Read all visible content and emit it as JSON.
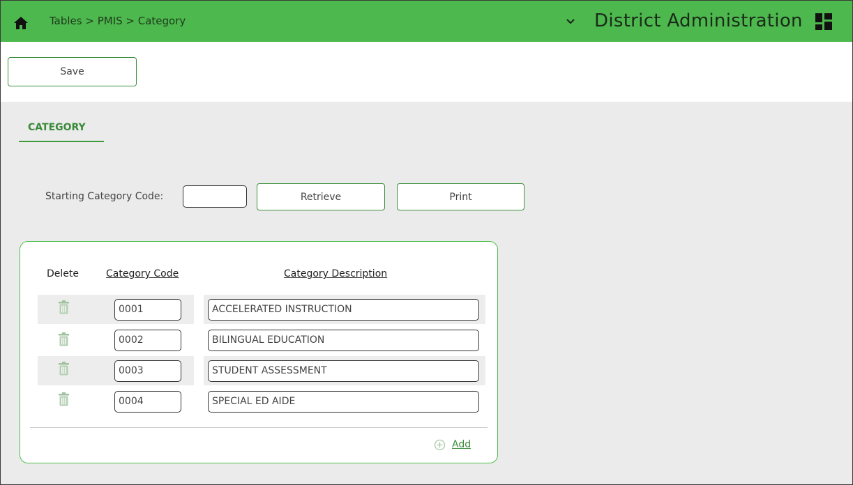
{
  "header": {
    "breadcrumb": "Tables > PMIS > Category",
    "app_title": "District Administration",
    "home_icon": "home-icon",
    "dropdown_icon": "chevron-down-icon",
    "menu_icon": "grid-menu-icon"
  },
  "toolbar": {
    "save_label": "Save"
  },
  "tab": {
    "label": "CATEGORY"
  },
  "filter": {
    "starting_label": "Starting Category Code:",
    "starting_value": "",
    "retrieve_label": "Retrieve",
    "print_label": "Print"
  },
  "table": {
    "headers": {
      "delete": "Delete",
      "code": "Category Code",
      "description": "Category Description"
    },
    "rows": [
      {
        "code": "0001",
        "description": "ACCELERATED INSTRUCTION"
      },
      {
        "code": "0002",
        "description": "BILINGUAL EDUCATION"
      },
      {
        "code": "0003",
        "description": "STUDENT ASSESSMENT"
      },
      {
        "code": "0004",
        "description": "SPECIAL ED AIDE"
      }
    ],
    "add_label": "Add"
  },
  "colors": {
    "header_green": "#4db84d",
    "accent_green": "#3a8a3a",
    "panel_border": "#4dbf4d",
    "background": "#ebebeb"
  }
}
